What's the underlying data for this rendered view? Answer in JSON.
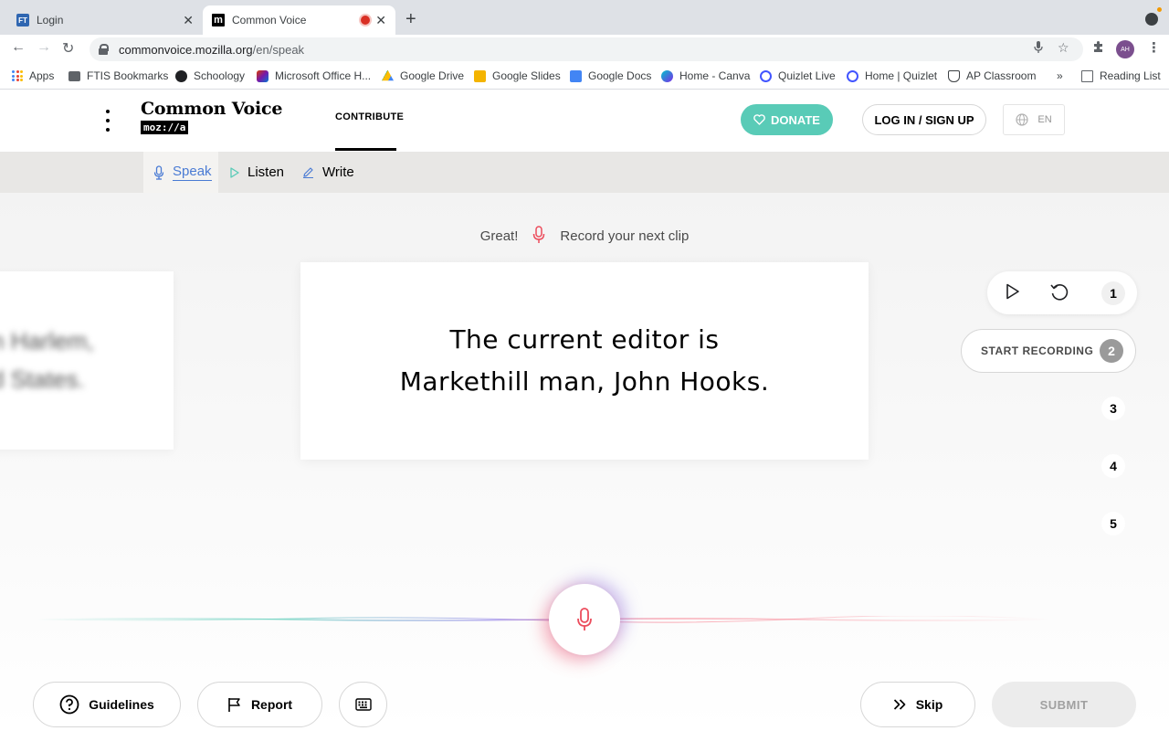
{
  "browser": {
    "tabs": [
      {
        "title": "Login",
        "favicon": "FT"
      },
      {
        "title": "Common Voice",
        "favicon": "m",
        "recording": true
      }
    ],
    "url_host": "commonvoice.mozilla.org",
    "url_path": "/en/speak",
    "avatar_initials": "AH",
    "bookmarks": [
      {
        "label": "Apps",
        "icon": "apps-grid-icon"
      },
      {
        "label": "FTIS Bookmarks",
        "icon": "folder-icon"
      },
      {
        "label": "Schoology",
        "icon": "schoology-icon"
      },
      {
        "label": "Microsoft Office H...",
        "icon": "office-icon"
      },
      {
        "label": "Google Drive",
        "icon": "drive-icon"
      },
      {
        "label": "Google Slides",
        "icon": "slides-icon"
      },
      {
        "label": "Google Docs",
        "icon": "docs-icon"
      },
      {
        "label": "Home - Canva",
        "icon": "canva-icon"
      },
      {
        "label": "Quizlet Live",
        "icon": "quizlet-icon"
      },
      {
        "label": "Home | Quizlet",
        "icon": "quizlet-icon"
      },
      {
        "label": "AP Classroom",
        "icon": "ap-icon"
      }
    ],
    "bookmarks_overflow": "»",
    "reading_list": "Reading List"
  },
  "header": {
    "logo_title": "Common Voice",
    "logo_sub": "moz://a",
    "nav_contribute": "CONTRIBUTE",
    "donate": "DONATE",
    "login": "LOG IN / SIGN UP",
    "lang": "EN"
  },
  "subnav": {
    "speak": "Speak",
    "listen": "Listen",
    "write": "Write"
  },
  "main": {
    "prompt_left": "Great!",
    "prompt_right": "Record your next clip",
    "prev_sentence_line1": "n Harlem,",
    "prev_sentence_line2": "d States.",
    "sentence_line1": "The current editor is",
    "sentence_line2": "Markethill man, John Hooks.",
    "clips": [
      "1",
      "2",
      "3",
      "4",
      "5"
    ],
    "start_recording": "START RECORDING"
  },
  "footer": {
    "guidelines": "Guidelines",
    "report": "Report",
    "skip": "Skip",
    "submit": "SUBMIT"
  },
  "colors": {
    "accent_blue": "#4a7bd4",
    "donate_green": "#59cbb7",
    "mic_red": "#ec4c5c"
  }
}
